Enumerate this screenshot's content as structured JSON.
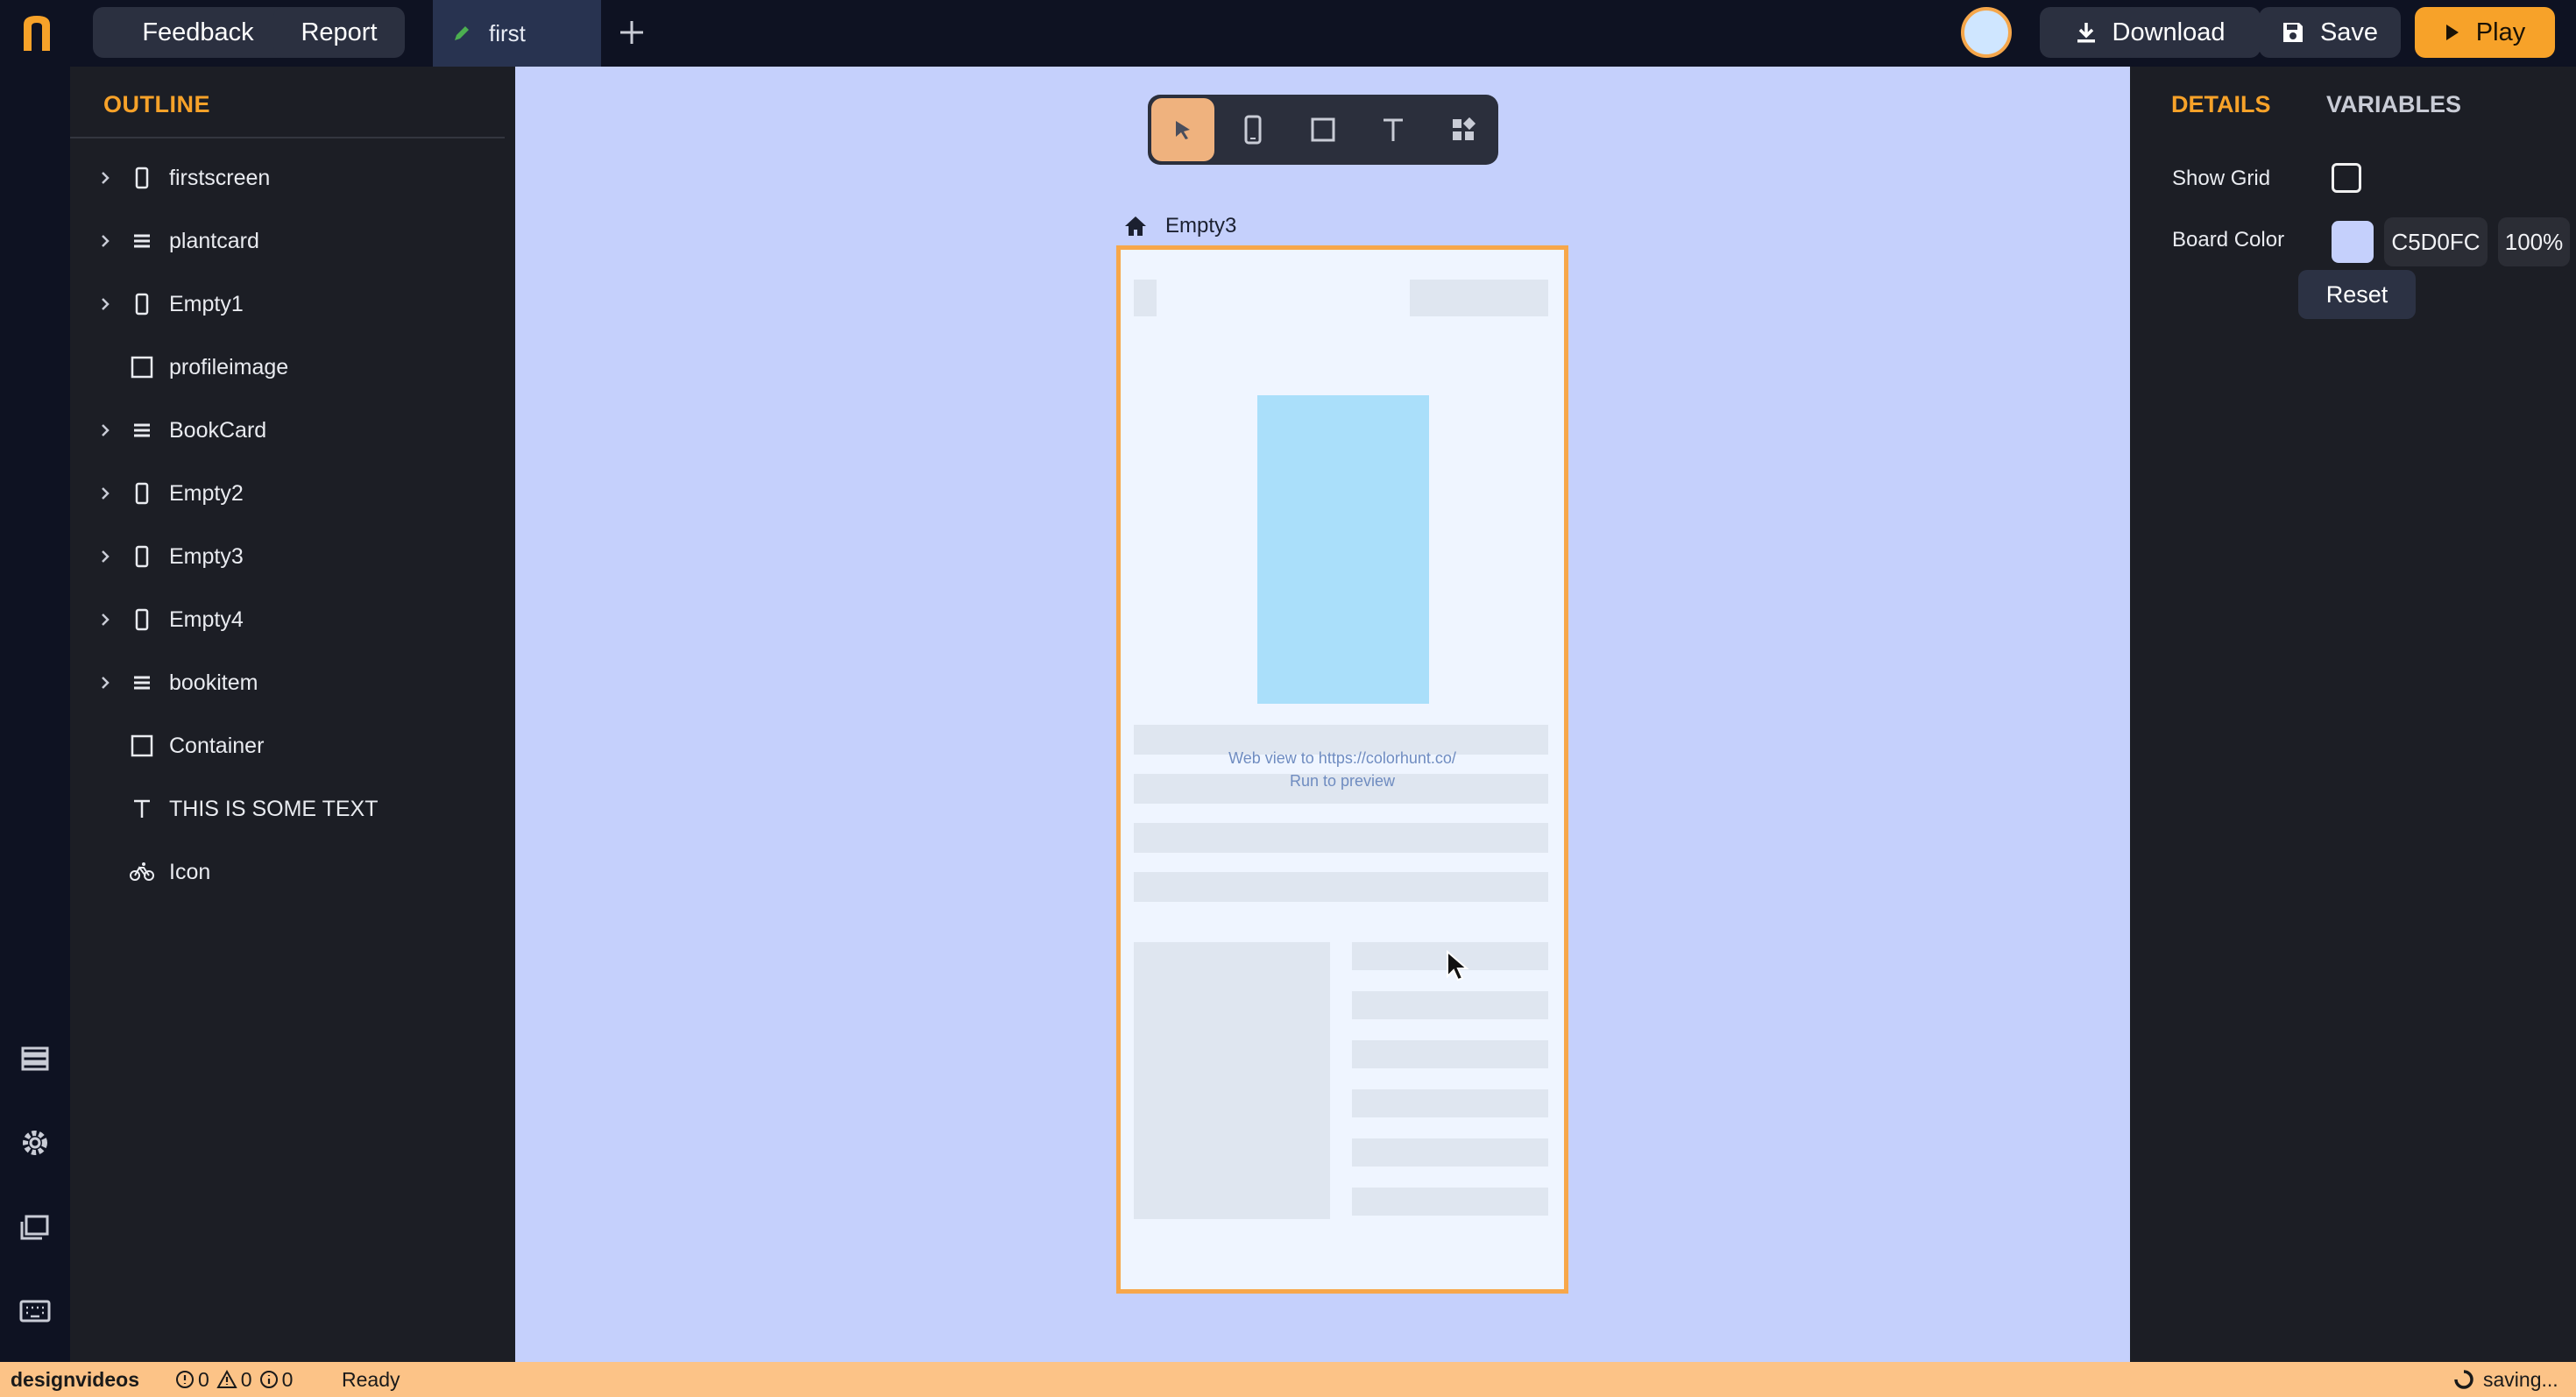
{
  "topbar": {
    "feedback_label": "Feedback",
    "report_label": "Report",
    "tab_label": "first",
    "download_label": "Download",
    "save_label": "Save",
    "play_label": "Play"
  },
  "outline": {
    "title": "OUTLINE",
    "items": [
      {
        "label": "firstscreen",
        "icon": "phone-icon",
        "expandable": true
      },
      {
        "label": "plantcard",
        "icon": "list-icon",
        "expandable": true
      },
      {
        "label": "Empty1",
        "icon": "phone-icon",
        "expandable": true
      },
      {
        "label": "profileimage",
        "icon": "square-icon",
        "expandable": false
      },
      {
        "label": "BookCard",
        "icon": "list-icon",
        "expandable": true
      },
      {
        "label": "Empty2",
        "icon": "phone-icon",
        "expandable": true
      },
      {
        "label": "Empty3",
        "icon": "phone-icon",
        "expandable": true
      },
      {
        "label": "Empty4",
        "icon": "phone-icon",
        "expandable": true
      },
      {
        "label": "bookitem",
        "icon": "list-icon",
        "expandable": true
      },
      {
        "label": "Container",
        "icon": "square-icon",
        "expandable": false
      },
      {
        "label": "THIS IS SOME TEXT",
        "icon": "text-icon",
        "expandable": false
      },
      {
        "label": "Icon",
        "icon": "bicycle-icon",
        "expandable": false
      }
    ]
  },
  "canvas": {
    "board_name": "Empty3",
    "webview_line1": "Web view to https://colorhunt.co/",
    "webview_line2": "Run to preview",
    "background": "#c5d0fc"
  },
  "details": {
    "tab_details": "DETAILS",
    "tab_variables": "VARIABLES",
    "show_grid_label": "Show Grid",
    "show_grid_checked": false,
    "board_color_label": "Board Color",
    "board_color_hex": "C5D0FC",
    "board_color_opacity": "100%",
    "reset_label": "Reset"
  },
  "statusbar": {
    "project": "designvideos",
    "errors": "0",
    "warnings": "0",
    "infos": "0",
    "state": "Ready",
    "saving": "saving..."
  },
  "colors": {
    "accent": "#f7a229",
    "board_border": "#f7a74a",
    "status_bg": "#fcc387"
  }
}
